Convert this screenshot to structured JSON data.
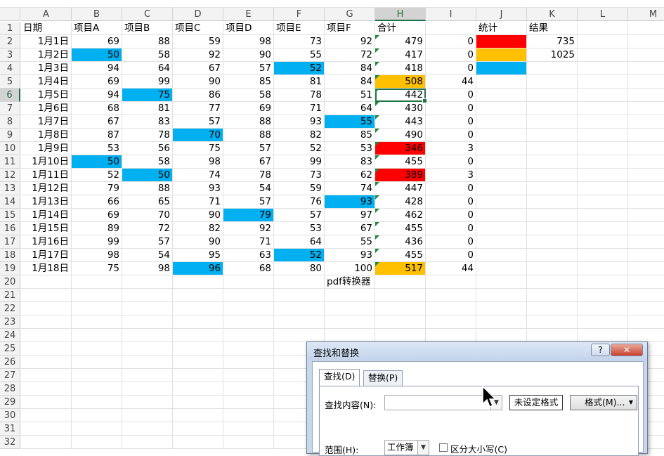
{
  "columns": [
    "A",
    "B",
    "C",
    "D",
    "E",
    "F",
    "G",
    "H",
    "I",
    "J",
    "K",
    "L",
    "M"
  ],
  "rows": [
    "1",
    "2",
    "3",
    "4",
    "5",
    "6",
    "7",
    "8",
    "9",
    "10",
    "11",
    "12",
    "13",
    "14",
    "15",
    "16",
    "17",
    "18",
    "19",
    "20",
    "21",
    "22",
    "23",
    "24",
    "25",
    "26",
    "27",
    "28",
    "29",
    "30",
    "31",
    "32"
  ],
  "active_column": "H",
  "active_row": "6",
  "headers": {
    "A": "日期",
    "B": "项目A",
    "C": "项目B",
    "D": "项目C",
    "E": "项目D",
    "F": "项目E",
    "G": "项目F",
    "H": "合计",
    "J": "统计",
    "K": "结果"
  },
  "data": [
    {
      "date": "1月1日",
      "b": "69",
      "c": "88",
      "d": "59",
      "e": "98",
      "f": "73",
      "g": "92",
      "h": "479",
      "i": "0"
    },
    {
      "date": "1月2日",
      "b": "50",
      "c": "58",
      "d": "92",
      "e": "90",
      "f": "55",
      "g": "72",
      "h": "417",
      "i": "0"
    },
    {
      "date": "1月3日",
      "b": "94",
      "c": "64",
      "d": "67",
      "e": "57",
      "f": "52",
      "g": "84",
      "h": "418",
      "i": "0"
    },
    {
      "date": "1月4日",
      "b": "69",
      "c": "99",
      "d": "90",
      "e": "85",
      "f": "81",
      "g": "84",
      "h": "508",
      "i": "44"
    },
    {
      "date": "1月5日",
      "b": "94",
      "c": "75",
      "d": "86",
      "e": "58",
      "f": "78",
      "g": "51",
      "h": "442",
      "i": "0"
    },
    {
      "date": "1月6日",
      "b": "68",
      "c": "81",
      "d": "77",
      "e": "69",
      "f": "71",
      "g": "64",
      "h": "430",
      "i": "0"
    },
    {
      "date": "1月7日",
      "b": "67",
      "c": "83",
      "d": "57",
      "e": "88",
      "f": "93",
      "g": "55",
      "h": "443",
      "i": "0"
    },
    {
      "date": "1月8日",
      "b": "87",
      "c": "78",
      "d": "70",
      "e": "88",
      "f": "82",
      "g": "85",
      "h": "490",
      "i": "0"
    },
    {
      "date": "1月9日",
      "b": "53",
      "c": "56",
      "d": "75",
      "e": "57",
      "f": "52",
      "g": "53",
      "h": "346",
      "i": "3"
    },
    {
      "date": "1月10日",
      "b": "50",
      "c": "58",
      "d": "98",
      "e": "67",
      "f": "99",
      "g": "83",
      "h": "455",
      "i": "0"
    },
    {
      "date": "1月11日",
      "b": "52",
      "c": "50",
      "d": "74",
      "e": "78",
      "f": "73",
      "g": "62",
      "h": "389",
      "i": "3"
    },
    {
      "date": "1月12日",
      "b": "79",
      "c": "88",
      "d": "93",
      "e": "54",
      "f": "59",
      "g": "74",
      "h": "447",
      "i": "0"
    },
    {
      "date": "1月13日",
      "b": "66",
      "c": "65",
      "d": "71",
      "e": "57",
      "f": "76",
      "g": "93",
      "h": "428",
      "i": "0"
    },
    {
      "date": "1月14日",
      "b": "69",
      "c": "70",
      "d": "90",
      "e": "79",
      "f": "57",
      "g": "97",
      "h": "462",
      "i": "0"
    },
    {
      "date": "1月15日",
      "b": "89",
      "c": "72",
      "d": "82",
      "e": "92",
      "f": "53",
      "g": "67",
      "h": "455",
      "i": "0"
    },
    {
      "date": "1月16日",
      "b": "99",
      "c": "57",
      "d": "90",
      "e": "71",
      "f": "64",
      "g": "55",
      "h": "436",
      "i": "0"
    },
    {
      "date": "1月17日",
      "b": "98",
      "c": "54",
      "d": "95",
      "e": "63",
      "f": "52",
      "g": "93",
      "h": "455",
      "i": "0"
    },
    {
      "date": "1月18日",
      "b": "75",
      "c": "98",
      "d": "96",
      "e": "68",
      "f": "80",
      "g": "100",
      "h": "517",
      "i": "44"
    }
  ],
  "fills": {
    "blue": "#00b0f0",
    "red": "#ff0000",
    "orange": "#ffc000",
    "blue_cells": [
      "B3",
      "F4",
      "C6",
      "G8",
      "D9",
      "B11",
      "C12",
      "G14",
      "E15",
      "F18",
      "D19"
    ],
    "red_cells": [
      "H10",
      "H12"
    ],
    "orange_cells": [
      "H5",
      "H19"
    ]
  },
  "legend": {
    "red_result": "735",
    "orange_result": "1025"
  },
  "g20_text": "pdf转换器",
  "dialog": {
    "title": "查找和替换",
    "help_label": "?",
    "close_label": "✕",
    "tab_find": "查找(D)",
    "tab_replace": "替换(P)",
    "find_label": "查找内容(N):",
    "find_value": "",
    "format_status": "未设定格式",
    "format_button": "格式(M)...",
    "scope_label": "范围(H):",
    "scope_value": "工作簿",
    "match_case_label": "区分大小写(C)"
  }
}
